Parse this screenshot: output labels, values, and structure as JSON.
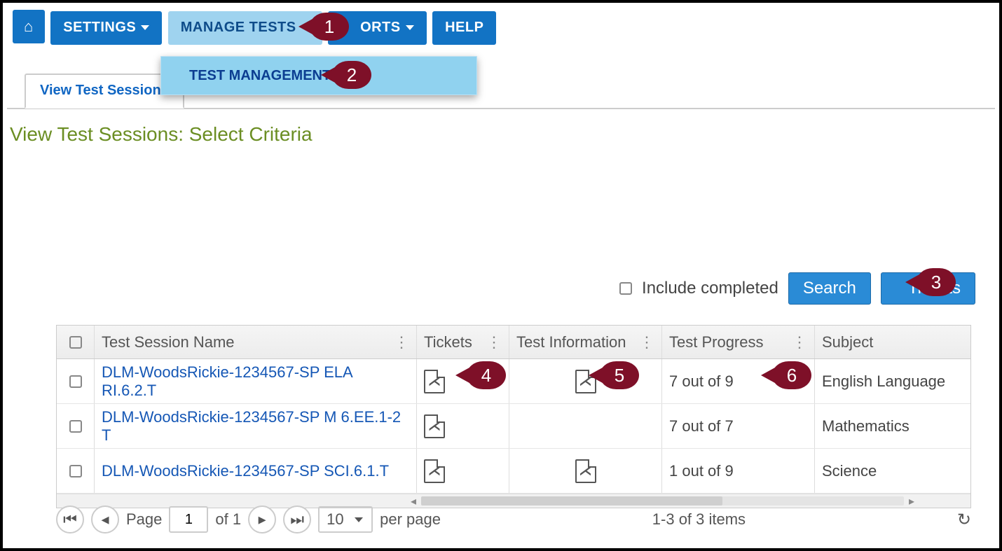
{
  "nav": {
    "home_label": "",
    "settings": "SETTINGS",
    "manage": "MANAGE TESTS",
    "reports": "ORTS",
    "help": "HELP",
    "dropdown_item": "TEST MANAGEMENT"
  },
  "tab": "View Test Sessions",
  "page_title": "View Test Sessions: Select Criteria",
  "actions": {
    "include_completed": "Include completed",
    "search": "Search",
    "tickets": "Tickets"
  },
  "columns": {
    "name": "Test Session Name",
    "tickets": "Tickets",
    "info": "Test Information",
    "progress": "Test Progress",
    "subject": "Subject"
  },
  "rows": [
    {
      "name": "DLM-WoodsRickie-1234567-SP ELA RI.6.2.T",
      "has_ticket": true,
      "has_info": true,
      "progress": "7 out of 9",
      "subject": "English Language"
    },
    {
      "name": "DLM-WoodsRickie-1234567-SP M 6.EE.1-2 T",
      "has_ticket": true,
      "has_info": false,
      "progress": "7 out of 7",
      "subject": "Mathematics"
    },
    {
      "name": "DLM-WoodsRickie-1234567-SP SCI.6.1.T",
      "has_ticket": true,
      "has_info": true,
      "progress": "1 out of 9",
      "subject": "Science"
    }
  ],
  "pager": {
    "page_label": "Page",
    "page": "1",
    "of": "of 1",
    "page_size": "10",
    "per_page": "per page",
    "count": "1-3 of 3 items"
  },
  "callouts": {
    "c1": "1",
    "c2": "2",
    "c3": "3",
    "c4": "4",
    "c5": "5",
    "c6": "6"
  }
}
